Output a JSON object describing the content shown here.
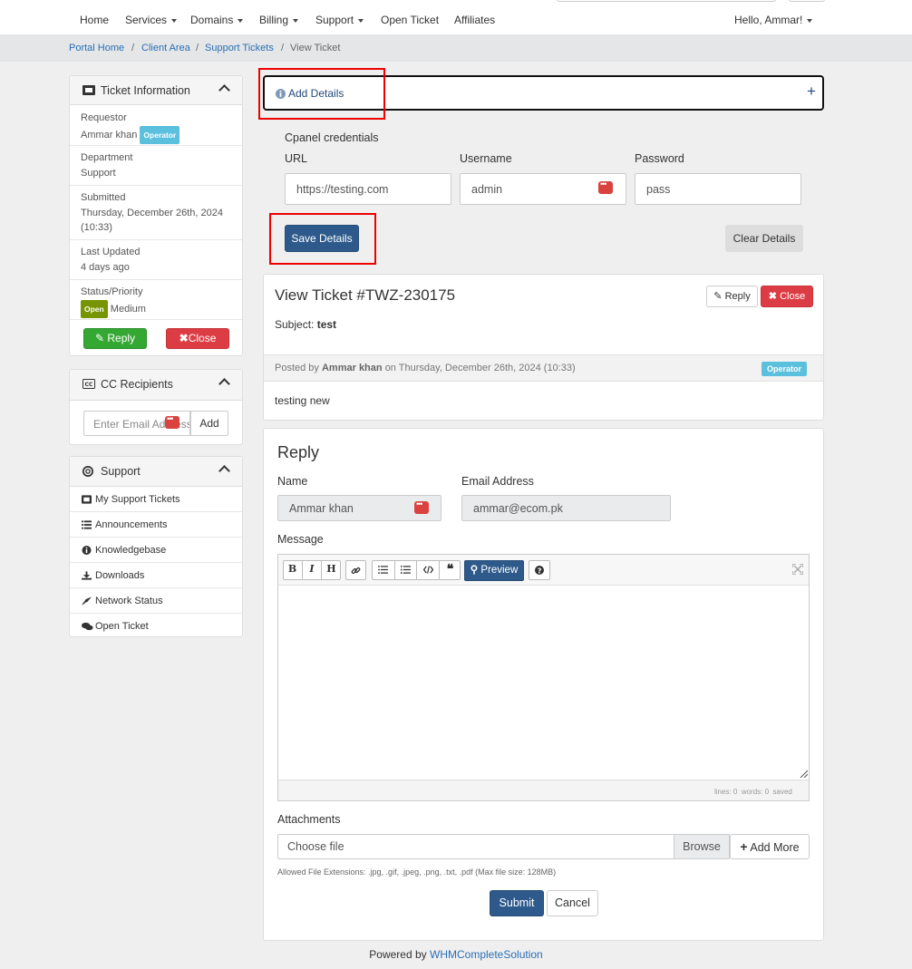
{
  "nav": {
    "items": [
      "Home",
      "Services",
      "Domains",
      "Billing",
      "Support",
      "Open Ticket",
      "Affiliates"
    ],
    "greeting": "Hello, Ammar!"
  },
  "breadcrumb": [
    "Portal Home",
    "Client Area",
    "Support Tickets",
    "View Ticket"
  ],
  "ticket_info": {
    "title": "Ticket Information",
    "requestor_label": "Requestor",
    "requestor_name": "Ammar khan",
    "requestor_badge": "Operator",
    "department_label": "Department",
    "department": "Support",
    "submitted_label": "Submitted",
    "submitted_line1": "Thursday, December 26th, 2024",
    "submitted_line2": "(10:33)",
    "last_updated_label": "Last Updated",
    "last_updated": "4 days ago",
    "status_label": "Status/Priority",
    "status": "Open",
    "priority": "Medium",
    "reply_button": "Reply",
    "close_button": "Close"
  },
  "cc": {
    "title": "CC Recipients",
    "placeholder": "Enter Email Address",
    "add_button": "Add"
  },
  "support_panel": {
    "title": "Support",
    "links": [
      "My Support Tickets",
      "Announcements",
      "Knowledgebase",
      "Downloads",
      "Network Status",
      "Open Ticket"
    ]
  },
  "add_details": {
    "label": "Add Details",
    "expand": "+",
    "section_title": "Cpanel credentials",
    "url_label": "URL",
    "url_value": "https://testing.com",
    "username_label": "Username",
    "username_value": "admin",
    "password_label": "Password",
    "password_value": "pass",
    "save_button": "Save Details",
    "clear_button": "Clear Details"
  },
  "ticket": {
    "title": "View Ticket #TWZ-230175",
    "reply_button": "Reply",
    "close_button": "Close",
    "subject_label": "Subject:",
    "subject": "test",
    "posted_by": "Posted by",
    "author": "Ammar khan",
    "posted_on": "on Thursday, December 26th, 2024 (10:33)",
    "author_badge": "Operator",
    "message": "testing new"
  },
  "reply": {
    "title": "Reply",
    "name_label": "Name",
    "name_value": "Ammar khan",
    "email_label": "Email Address",
    "email_value": "ammar@ecom.pk",
    "message_label": "Message",
    "toolbar": {
      "bold": "B",
      "italic": "I",
      "heading": "H",
      "preview": "Preview"
    },
    "status_lines": "lines: 0",
    "status_words": "words: 0",
    "status_saved": "saved",
    "attachments_label": "Attachments",
    "file_placeholder": "Choose file",
    "browse_button": "Browse",
    "add_more_button": "Add More",
    "allowed_ext": "Allowed File Extensions: .jpg, .gif, .jpeg, .png, .txt, .pdf (Max file size: 128MB)",
    "submit_button": "Submit",
    "cancel_button": "Cancel"
  },
  "footer": {
    "powered_by": "Powered by",
    "brand": "WHMCompleteSolution"
  },
  "colors": {
    "primary": "#2e5a8b",
    "success": "#35a833",
    "danger": "#dc3d44",
    "info": "#5bc0de",
    "open_badge": "#779500",
    "highlight_box": "#ee0000"
  }
}
